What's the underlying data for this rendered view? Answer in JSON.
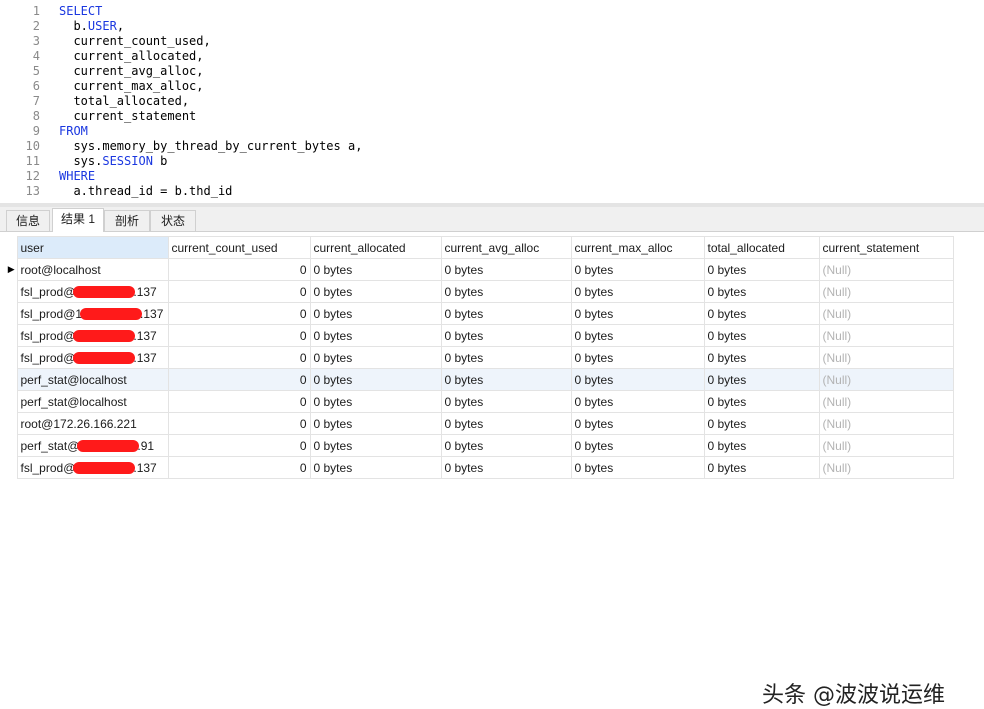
{
  "editor": {
    "line_numbers": [
      "1",
      "2",
      "3",
      "4",
      "5",
      "6",
      "7",
      "8",
      "9",
      "10",
      "11",
      "12",
      "13"
    ],
    "lines": [
      {
        "kw": "SELECT",
        "pre": "",
        "post": ""
      },
      {
        "kw": "",
        "pre": "  b.",
        "post": ","
      },
      {
        "kw": "",
        "pre": "  current_count_used,",
        "post": ""
      },
      {
        "kw": "",
        "pre": "  current_allocated,",
        "post": ""
      },
      {
        "kw": "",
        "pre": "  current_avg_alloc,",
        "post": ""
      },
      {
        "kw": "",
        "pre": "  current_max_alloc,",
        "post": ""
      },
      {
        "kw": "",
        "pre": "  total_allocated,",
        "post": ""
      },
      {
        "kw": "",
        "pre": "  current_statement",
        "post": ""
      },
      {
        "kw": "FROM",
        "pre": "",
        "post": ""
      },
      {
        "kw": "",
        "pre": "  sys.memory_by_thread_by_current_bytes a,",
        "post": ""
      },
      {
        "kw": "",
        "pre": "  sys.",
        "post": " b"
      },
      {
        "kw": "WHERE",
        "pre": "",
        "post": ""
      },
      {
        "kw": "",
        "pre": "  a.thread_id = b.thd_id",
        "post": ""
      }
    ],
    "inline_keywords": {
      "line2": "USER",
      "line11": "SESSION"
    }
  },
  "tabs": [
    {
      "label": "信息",
      "active": false
    },
    {
      "label": "结果 1",
      "active": true
    },
    {
      "label": "剖析",
      "active": false
    },
    {
      "label": "状态",
      "active": false
    }
  ],
  "grid": {
    "columns": [
      "user",
      "current_count_used",
      "current_allocated",
      "current_avg_alloc",
      "current_max_alloc",
      "total_allocated",
      "current_statement"
    ],
    "rows": [
      {
        "user_pre": "root@localhost",
        "user_post": "",
        "redacted": false,
        "count": "0",
        "alloc": "0 bytes",
        "avg": "0 bytes",
        "max": "0 bytes",
        "total": "0 bytes",
        "stmt": "(Null)",
        "current": true,
        "highlight": false
      },
      {
        "user_pre": "fsl_prod@",
        "user_post": ".137",
        "redacted": true,
        "count": "0",
        "alloc": "0 bytes",
        "avg": "0 bytes",
        "max": "0 bytes",
        "total": "0 bytes",
        "stmt": "(Null)",
        "current": false,
        "highlight": false
      },
      {
        "user_pre": "fsl_prod@1",
        "user_post": ".137",
        "redacted": true,
        "count": "0",
        "alloc": "0 bytes",
        "avg": "0 bytes",
        "max": "0 bytes",
        "total": "0 bytes",
        "stmt": "(Null)",
        "current": false,
        "highlight": false
      },
      {
        "user_pre": "fsl_prod@",
        "user_post": ".137",
        "redacted": true,
        "count": "0",
        "alloc": "0 bytes",
        "avg": "0 bytes",
        "max": "0 bytes",
        "total": "0 bytes",
        "stmt": "(Null)",
        "current": false,
        "highlight": false
      },
      {
        "user_pre": "fsl_prod@",
        "user_post": ".137",
        "redacted": true,
        "count": "0",
        "alloc": "0 bytes",
        "avg": "0 bytes",
        "max": "0 bytes",
        "total": "0 bytes",
        "stmt": "(Null)",
        "current": false,
        "highlight": false
      },
      {
        "user_pre": "perf_stat@localhost",
        "user_post": "",
        "redacted": false,
        "count": "0",
        "alloc": "0 bytes",
        "avg": "0 bytes",
        "max": "0 bytes",
        "total": "0 bytes",
        "stmt": "(Null)",
        "current": false,
        "highlight": true
      },
      {
        "user_pre": "perf_stat@localhost",
        "user_post": "",
        "redacted": false,
        "count": "0",
        "alloc": "0 bytes",
        "avg": "0 bytes",
        "max": "0 bytes",
        "total": "0 bytes",
        "stmt": "(Null)",
        "current": false,
        "highlight": false
      },
      {
        "user_pre": "root@172.26.166.221",
        "user_post": "",
        "redacted": false,
        "count": "0",
        "alloc": "0 bytes",
        "avg": "0 bytes",
        "max": "0 bytes",
        "total": "0 bytes",
        "stmt": "(Null)",
        "current": false,
        "highlight": false
      },
      {
        "user_pre": "perf_stat@",
        "user_post": ".91",
        "redacted": true,
        "count": "0",
        "alloc": "0 bytes",
        "avg": "0 bytes",
        "max": "0 bytes",
        "total": "0 bytes",
        "stmt": "(Null)",
        "current": false,
        "highlight": false
      },
      {
        "user_pre": "fsl_prod@",
        "user_post": ".137",
        "redacted": true,
        "count": "0",
        "alloc": "0 bytes",
        "avg": "0 bytes",
        "max": "0 bytes",
        "total": "0 bytes",
        "stmt": "(Null)",
        "current": false,
        "highlight": false
      }
    ]
  },
  "watermark": "头条 @波波说运维",
  "colors": {
    "keyword": "#1a37e0",
    "line_number": "#8a8a8a",
    "null_text": "#b3b3b3",
    "redaction": "#ff1a1a",
    "header_selected": "#dcebfa"
  }
}
